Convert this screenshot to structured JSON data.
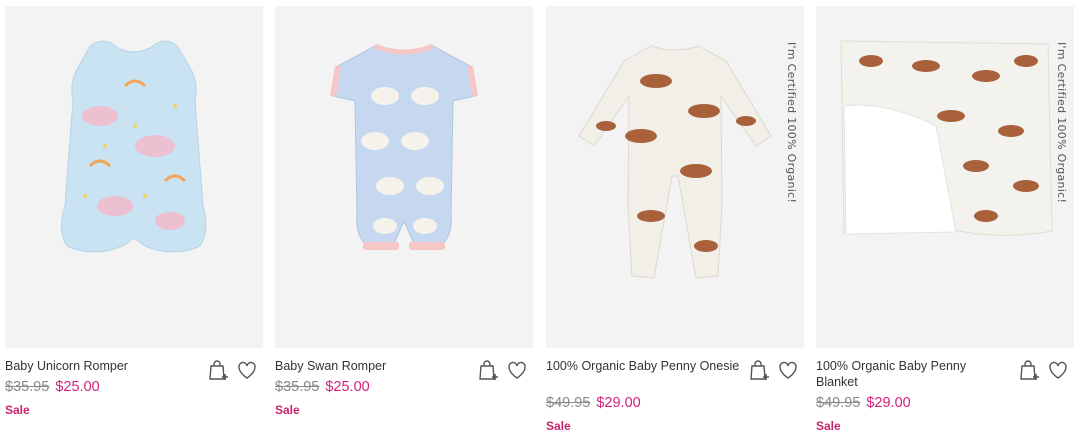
{
  "products": [
    {
      "name": "Baby Unicorn Romper",
      "original_price": "$35.95",
      "sale_price": "$25.00",
      "tag": "Sale",
      "badge": ""
    },
    {
      "name": "Baby Swan Romper",
      "original_price": "$35.95",
      "sale_price": "$25.00",
      "tag": "Sale",
      "badge": ""
    },
    {
      "name": "100% Organic Baby Penny Onesie",
      "original_price": "$49.95",
      "sale_price": "$29.00",
      "tag": "Sale",
      "badge": "I'm Certified 100% Organic!"
    },
    {
      "name": "100% Organic Baby Penny Blanket",
      "original_price": "$49.95",
      "sale_price": "$29.00",
      "tag": "Sale",
      "badge": "I'm Certified 100% Organic!"
    }
  ],
  "icons": {
    "add_to_bag": "shopping-bag-plus-icon",
    "wishlist": "heart-icon"
  },
  "colors": {
    "sale_price": "#d4217a",
    "sale_tag": "#c8246f",
    "original_price": "#888888",
    "image_bg": "#f3f3f3"
  }
}
